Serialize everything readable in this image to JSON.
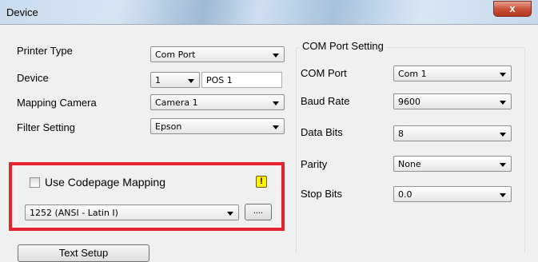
{
  "window": {
    "title": "Device",
    "close_label": "x"
  },
  "left": {
    "printer_type": {
      "label": "Printer Type",
      "value": "Com Port"
    },
    "device": {
      "label": "Device",
      "number": "1",
      "name": "POS 1"
    },
    "mapping_camera": {
      "label": "Mapping Camera",
      "value": "Camera 1"
    },
    "filter_setting": {
      "label": "Filter Setting",
      "value": "Epson"
    }
  },
  "codepage": {
    "checkbox_label": "Use Codepage Mapping",
    "checked": false,
    "warning_glyph": "!",
    "value": "1252  (ANSI - Latin I)",
    "browse_label": "...."
  },
  "text_setup_label": "Text Setup",
  "com_port_setting": {
    "title": "COM Port Setting",
    "com_port": {
      "label": "COM Port",
      "value": "Com 1"
    },
    "baud_rate": {
      "label": "Baud Rate",
      "value": "9600"
    },
    "data_bits": {
      "label": "Data Bits",
      "value": "8"
    },
    "parity": {
      "label": "Parity",
      "value": "None"
    },
    "stop_bits": {
      "label": "Stop Bits",
      "value": "0.0"
    }
  },
  "colors": {
    "highlight_border": "#e5242b",
    "warning_fill": "#fff200"
  }
}
